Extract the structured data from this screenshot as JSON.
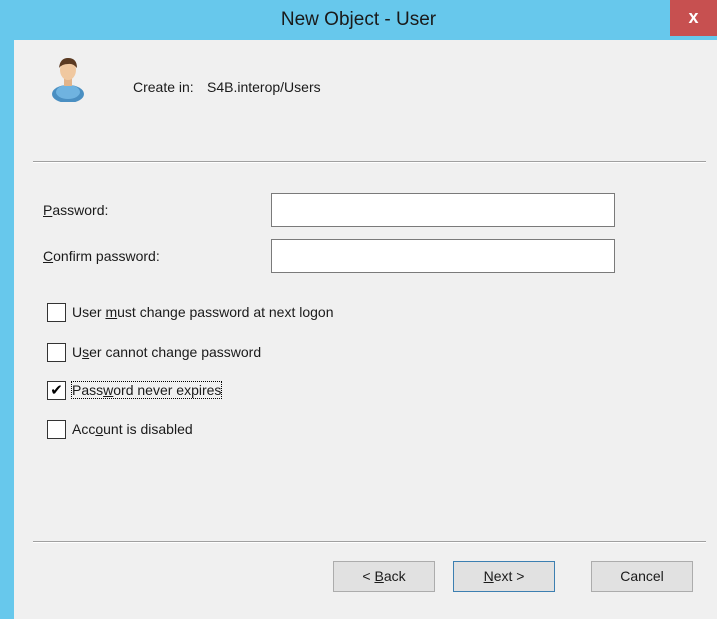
{
  "window": {
    "title": "New Object - User",
    "close_glyph": "x"
  },
  "header": {
    "icon": "user-icon",
    "create_label": "Create in:",
    "create_path": "S4B.interop/Users"
  },
  "fields": {
    "password": {
      "label_mnemonic": "P",
      "label_rest": "assword:",
      "value": ""
    },
    "confirm": {
      "label_mnemonic": "C",
      "label_rest": "onfirm password:",
      "value": ""
    }
  },
  "options": [
    {
      "pre": "User ",
      "mnemonic": "m",
      "post": "ust change password at next logon",
      "checked": false
    },
    {
      "pre": "U",
      "mnemonic": "s",
      "post": "er cannot change password",
      "checked": false
    },
    {
      "pre": "Pass",
      "mnemonic": "w",
      "post": "ord never expires",
      "checked": true
    },
    {
      "pre": "Acc",
      "mnemonic": "o",
      "post": "unt is disabled",
      "checked": false
    }
  ],
  "buttons": {
    "back": {
      "pre": "< ",
      "mnemonic": "B",
      "post": "ack"
    },
    "next": {
      "pre": "",
      "mnemonic": "N",
      "post": "ext >"
    },
    "cancel": "Cancel"
  },
  "colors": {
    "titlebar": "#67c8ec",
    "close": "#c75050",
    "content_bg": "#f0f0f0"
  }
}
